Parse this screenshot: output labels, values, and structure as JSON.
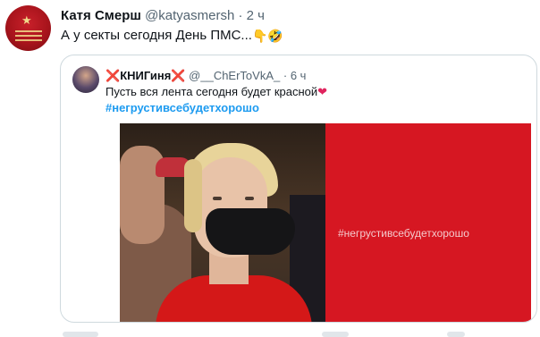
{
  "tweet": {
    "author_name": "Катя Смерш",
    "author_handle": "@katyasmersh",
    "separator": "·",
    "time": "2 ч",
    "text": "А у секты сегодня День ПМС...",
    "emoji1": "👇",
    "emoji2": "🤣"
  },
  "quoted": {
    "author_name": "КНИГиня",
    "name_decoration": "❌",
    "author_handle": "@__ChErToVkA_",
    "separator": "·",
    "time": "6 ч",
    "text": "Пусть вся лента сегодня будет красной",
    "heart": "❤",
    "hashtag": "#негрустивсебудетхорошо",
    "media": {
      "left_image": "photo-woman-blonde-black-mask-red-top",
      "right_panel_color": "#d61722",
      "right_panel_text": "#негрустивсебудетхорошо"
    }
  },
  "colors": {
    "text_primary": "#0f1419",
    "text_secondary": "#536471",
    "link": "#1d9bf0",
    "border": "#cfd9de",
    "accent_red": "#d61722"
  }
}
